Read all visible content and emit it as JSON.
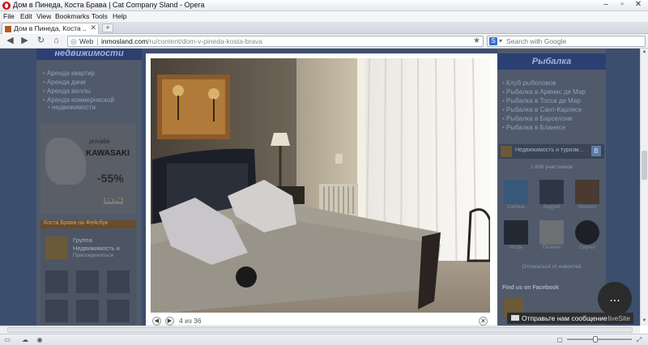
{
  "window": {
    "title": "Дом в Пинеда, Коста Брава | Cat Company Sland - Opera",
    "controls": [
      "–",
      "▫",
      "✕"
    ]
  },
  "menu": [
    "File",
    "Edit",
    "View",
    "Bookmarks",
    "Tools",
    "Help"
  ],
  "tab": {
    "title": "Дом в Пинеда, Коста ...",
    "close": "✕",
    "new": "+"
  },
  "nav": {
    "back": "◀",
    "forward": "▶",
    "reload": "↻",
    "home": "⌂",
    "addr_label": "Web",
    "url_domain": "inmosland.com",
    "url_path": "/ru/content/dom-v-pineda-kosta-brava",
    "search_placeholder": "Search with Google",
    "search_engine_icon": "S"
  },
  "page": {
    "left_banner": "недвижимости",
    "left_links": [
      "Аренда квартир",
      "Аренда дачи",
      "Аренда виллы",
      "Аренда коммерческой",
      "недвижимости"
    ],
    "ad": {
      "brand": "privalia",
      "title": "KAWASAKI",
      "discount": "-55%",
      "cta": "ENTRA"
    },
    "group_box": {
      "header": "Коста Брава на Фейсбук",
      "title": "Группа",
      "sub": "Недвижимость и",
      "more": "Присоединиться"
    },
    "right_banner": "Рыбалка",
    "right_links": [
      "Клуб рыболовов",
      "Рыбалка в Аренис де Мар",
      "Рыбалка в Тосса де Мар",
      "Рыбалка в Сант-Карлесе",
      "Рыбалка в Барселоне",
      "Рыбалка в Бланесе"
    ],
    "vk": {
      "title": "Недвижимость и туризм...",
      "count": "1 896 участников",
      "members": [
        "Сабина",
        "Андрей",
        "Михаил",
        "Игорь",
        "Евгения",
        "Сергей"
      ],
      "unsub": "Отписаться от новостей"
    },
    "facebook_label": "Find us on Facebook"
  },
  "lightbox": {
    "counter": "4 из 36",
    "prev": "◀",
    "next": "▶",
    "close": "✕"
  },
  "livechat": {
    "label": "Отправьте нам сообщение",
    "brand": "liveSite",
    "chat_icon": "..."
  },
  "colors": {
    "accent": "#2b3f72",
    "overlay": "#3c4e6e",
    "opera_red": "#d0101b"
  }
}
